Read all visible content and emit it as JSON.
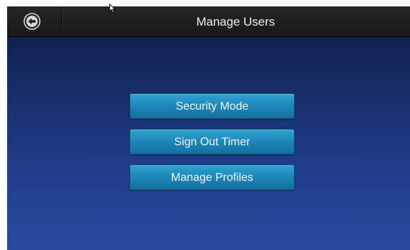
{
  "header": {
    "title": "Manage Users",
    "back_icon": "arrow-left-circle-icon"
  },
  "menu": {
    "buttons": [
      {
        "label": "Security Mode"
      },
      {
        "label": "Sign Out Timer"
      },
      {
        "label": "Manage Profiles"
      }
    ]
  },
  "colors": {
    "header_bg": "#1f1f1f",
    "content_top": "#10214f",
    "content_bottom": "#2a4aa0",
    "button": "#1d86b8"
  }
}
